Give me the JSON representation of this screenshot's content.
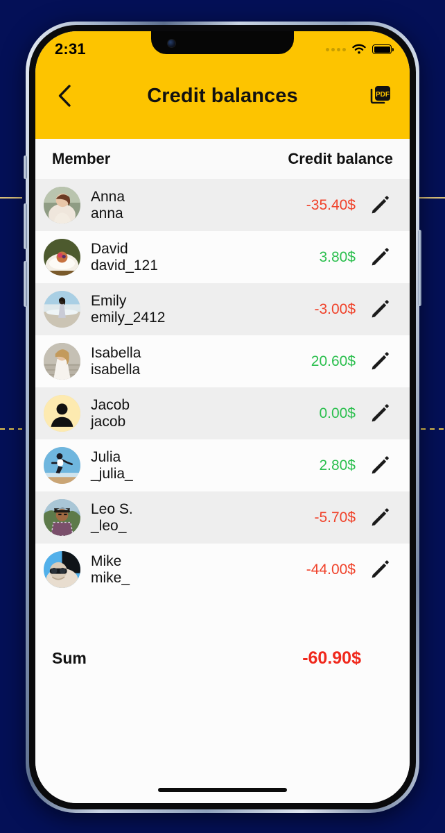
{
  "status_bar": {
    "time": "2:31",
    "cellular_icon": "signal-dots-icon",
    "wifi_icon": "wifi-icon",
    "battery_icon": "battery-full-icon"
  },
  "nav": {
    "back_icon": "chevron-left-icon",
    "title": "Credit balances",
    "pdf_icon": "pdf-export-icon"
  },
  "table": {
    "headers": {
      "member": "Member",
      "balance": "Credit balance"
    },
    "rows": [
      {
        "name": "Anna",
        "username": "anna",
        "amount": "-35.40$",
        "sign": "neg",
        "avatar": "photo-anna",
        "edit_icon": "pencil-icon"
      },
      {
        "name": "David",
        "username": "david_121",
        "amount": "3.80$",
        "sign": "pos",
        "avatar": "photo-david",
        "edit_icon": "pencil-icon"
      },
      {
        "name": "Emily",
        "username": "emily_2412",
        "amount": "-3.00$",
        "sign": "neg",
        "avatar": "photo-emily",
        "edit_icon": "pencil-icon"
      },
      {
        "name": "Isabella",
        "username": "isabella",
        "amount": "20.60$",
        "sign": "pos",
        "avatar": "photo-isabella",
        "edit_icon": "pencil-icon"
      },
      {
        "name": "Jacob",
        "username": "jacob",
        "amount": "0.00$",
        "sign": "pos",
        "avatar": "placeholder-person",
        "edit_icon": "pencil-icon"
      },
      {
        "name": "Julia",
        "username": "_julia_",
        "amount": "2.80$",
        "sign": "pos",
        "avatar": "photo-julia",
        "edit_icon": "pencil-icon"
      },
      {
        "name": "Leo S.",
        "username": "_leo_",
        "amount": "-5.70$",
        "sign": "neg",
        "avatar": "photo-leo",
        "edit_icon": "pencil-icon"
      },
      {
        "name": "Mike",
        "username": "mike_",
        "amount": "-44.00$",
        "sign": "neg",
        "avatar": "photo-mike",
        "edit_icon": "pencil-icon"
      }
    ],
    "sum": {
      "label": "Sum",
      "value": "-60.90$"
    }
  },
  "colors": {
    "brand_yellow": "#fdc400",
    "negative": "#f0422a",
    "positive": "#2bbf4e",
    "sum_negative": "#f0281c",
    "row_alt": "#eeeeee",
    "backdrop": "#041057"
  }
}
